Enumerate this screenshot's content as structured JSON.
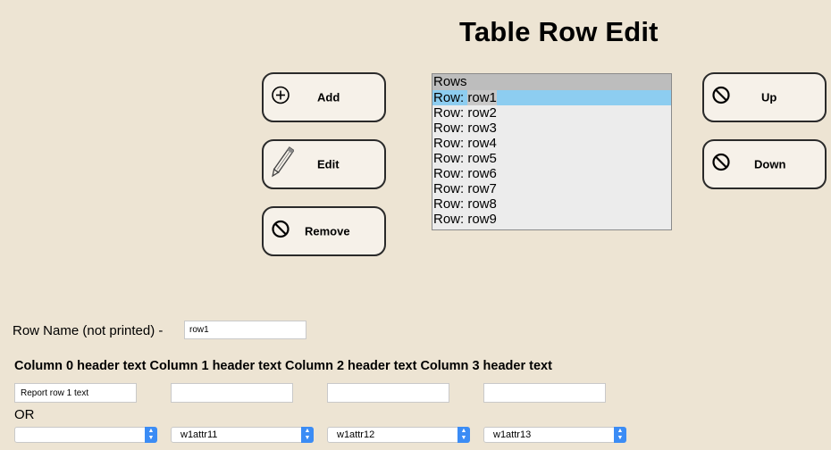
{
  "title": "Table Row Edit",
  "buttons": {
    "add": "Add",
    "edit": "Edit",
    "remove": "Remove",
    "up": "Up",
    "down": "Down"
  },
  "rows_list": {
    "header": "Rows",
    "prefix": "Row: ",
    "items": [
      "row1",
      "row2",
      "row3",
      "row4",
      "row5",
      "row6",
      "row7",
      "row8",
      "row9"
    ],
    "selected": "row1"
  },
  "row_name": {
    "label": "Row Name (not printed) -",
    "value": "row1"
  },
  "columns": [
    {
      "header": "Column 0 header text",
      "text_value": "Report row 1 text",
      "select_value": ""
    },
    {
      "header": "Column 1 header text",
      "text_value": "",
      "select_value": "w1attr11"
    },
    {
      "header": "Column 2 header text",
      "text_value": "",
      "select_value": "w1attr12"
    },
    {
      "header": "Column 3 header text",
      "text_value": "",
      "select_value": "w1attr13"
    }
  ],
  "or_label": "OR",
  "icons": {
    "add": "plus-circle-icon",
    "edit": "pencil-icon",
    "remove": "prohibited-icon",
    "up": "prohibited-icon",
    "down": "prohibited-icon"
  },
  "colors": {
    "background": "#ede4d3",
    "button_bg": "#f6f1e9",
    "selection": "#8dcdf0",
    "list_header": "#bdbdbd",
    "select_arrow": "#3b8cf5"
  }
}
